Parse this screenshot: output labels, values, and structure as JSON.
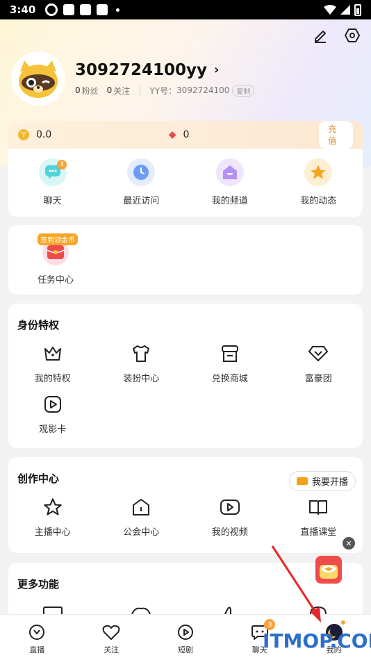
{
  "status_bar": {
    "time": "3:40"
  },
  "profile": {
    "username": "3092724100yy",
    "fans_count": "0",
    "fans_label": "粉丝",
    "follow_count": "0",
    "follow_label": "关注",
    "yy_label": "YY号：",
    "yy_id": "3092724100",
    "copy_label": "复制"
  },
  "wallet": {
    "coins": "0.0",
    "diamonds": "0",
    "recharge_label": "充值"
  },
  "quick_actions": [
    {
      "label": "聊天",
      "badge": "3",
      "icon": "chat-icon",
      "color": "#4fd3d9"
    },
    {
      "label": "最近访问",
      "icon": "clock-icon",
      "color": "#6b9bf5"
    },
    {
      "label": "我的频道",
      "icon": "channel-icon",
      "color": "#b590f2"
    },
    {
      "label": "我的动态",
      "icon": "star-icon",
      "color": "#f5a623"
    }
  ],
  "task": {
    "tag": "签到领金币",
    "label": "任务中心"
  },
  "identity": {
    "title": "身份特权",
    "items": [
      {
        "label": "我的特权",
        "icon": "crown-icon"
      },
      {
        "label": "装扮中心",
        "icon": "shirt-icon"
      },
      {
        "label": "兑换商城",
        "icon": "shop-icon"
      },
      {
        "label": "富豪团",
        "icon": "diamond-icon"
      },
      {
        "label": "观影卡",
        "icon": "play-card-icon"
      }
    ]
  },
  "creator": {
    "title": "创作中心",
    "live_button": "我要开播",
    "items": [
      {
        "label": "主播中心",
        "icon": "star-outline-icon"
      },
      {
        "label": "公会中心",
        "icon": "house-icon"
      },
      {
        "label": "我的视频",
        "icon": "video-icon"
      },
      {
        "label": "直播课堂",
        "icon": "book-icon"
      }
    ]
  },
  "more": {
    "title": "更多功能"
  },
  "tabs": [
    {
      "label": "直播",
      "icon": "live-tab-icon"
    },
    {
      "label": "关注",
      "icon": "heart-icon"
    },
    {
      "label": "短剧",
      "icon": "play-icon"
    },
    {
      "label": "聊天",
      "icon": "chat-bubble-icon",
      "badge": "3"
    },
    {
      "label": "我的",
      "icon": "moon-avatar-icon"
    }
  ],
  "watermark": "ITMOP.COM"
}
